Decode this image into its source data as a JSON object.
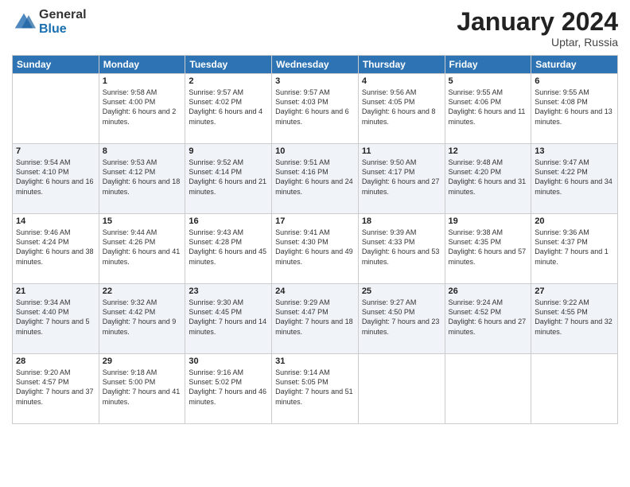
{
  "header": {
    "logo_general": "General",
    "logo_blue": "Blue",
    "month_year": "January 2024",
    "location": "Uptar, Russia"
  },
  "days_of_week": [
    "Sunday",
    "Monday",
    "Tuesday",
    "Wednesday",
    "Thursday",
    "Friday",
    "Saturday"
  ],
  "weeks": [
    [
      {
        "day": "",
        "info": ""
      },
      {
        "day": "1",
        "info": "Sunrise: 9:58 AM\nSunset: 4:00 PM\nDaylight: 6 hours\nand 2 minutes."
      },
      {
        "day": "2",
        "info": "Sunrise: 9:57 AM\nSunset: 4:02 PM\nDaylight: 6 hours\nand 4 minutes."
      },
      {
        "day": "3",
        "info": "Sunrise: 9:57 AM\nSunset: 4:03 PM\nDaylight: 6 hours\nand 6 minutes."
      },
      {
        "day": "4",
        "info": "Sunrise: 9:56 AM\nSunset: 4:05 PM\nDaylight: 6 hours\nand 8 minutes."
      },
      {
        "day": "5",
        "info": "Sunrise: 9:55 AM\nSunset: 4:06 PM\nDaylight: 6 hours\nand 11 minutes."
      },
      {
        "day": "6",
        "info": "Sunrise: 9:55 AM\nSunset: 4:08 PM\nDaylight: 6 hours\nand 13 minutes."
      }
    ],
    [
      {
        "day": "7",
        "info": "Sunrise: 9:54 AM\nSunset: 4:10 PM\nDaylight: 6 hours\nand 16 minutes."
      },
      {
        "day": "8",
        "info": "Sunrise: 9:53 AM\nSunset: 4:12 PM\nDaylight: 6 hours\nand 18 minutes."
      },
      {
        "day": "9",
        "info": "Sunrise: 9:52 AM\nSunset: 4:14 PM\nDaylight: 6 hours\nand 21 minutes."
      },
      {
        "day": "10",
        "info": "Sunrise: 9:51 AM\nSunset: 4:16 PM\nDaylight: 6 hours\nand 24 minutes."
      },
      {
        "day": "11",
        "info": "Sunrise: 9:50 AM\nSunset: 4:17 PM\nDaylight: 6 hours\nand 27 minutes."
      },
      {
        "day": "12",
        "info": "Sunrise: 9:48 AM\nSunset: 4:20 PM\nDaylight: 6 hours\nand 31 minutes."
      },
      {
        "day": "13",
        "info": "Sunrise: 9:47 AM\nSunset: 4:22 PM\nDaylight: 6 hours\nand 34 minutes."
      }
    ],
    [
      {
        "day": "14",
        "info": "Sunrise: 9:46 AM\nSunset: 4:24 PM\nDaylight: 6 hours\nand 38 minutes."
      },
      {
        "day": "15",
        "info": "Sunrise: 9:44 AM\nSunset: 4:26 PM\nDaylight: 6 hours\nand 41 minutes."
      },
      {
        "day": "16",
        "info": "Sunrise: 9:43 AM\nSunset: 4:28 PM\nDaylight: 6 hours\nand 45 minutes."
      },
      {
        "day": "17",
        "info": "Sunrise: 9:41 AM\nSunset: 4:30 PM\nDaylight: 6 hours\nand 49 minutes."
      },
      {
        "day": "18",
        "info": "Sunrise: 9:39 AM\nSunset: 4:33 PM\nDaylight: 6 hours\nand 53 minutes."
      },
      {
        "day": "19",
        "info": "Sunrise: 9:38 AM\nSunset: 4:35 PM\nDaylight: 6 hours\nand 57 minutes."
      },
      {
        "day": "20",
        "info": "Sunrise: 9:36 AM\nSunset: 4:37 PM\nDaylight: 7 hours\nand 1 minute."
      }
    ],
    [
      {
        "day": "21",
        "info": "Sunrise: 9:34 AM\nSunset: 4:40 PM\nDaylight: 7 hours\nand 5 minutes."
      },
      {
        "day": "22",
        "info": "Sunrise: 9:32 AM\nSunset: 4:42 PM\nDaylight: 7 hours\nand 9 minutes."
      },
      {
        "day": "23",
        "info": "Sunrise: 9:30 AM\nSunset: 4:45 PM\nDaylight: 7 hours\nand 14 minutes."
      },
      {
        "day": "24",
        "info": "Sunrise: 9:29 AM\nSunset: 4:47 PM\nDaylight: 7 hours\nand 18 minutes."
      },
      {
        "day": "25",
        "info": "Sunrise: 9:27 AM\nSunset: 4:50 PM\nDaylight: 7 hours\nand 23 minutes."
      },
      {
        "day": "26",
        "info": "Sunrise: 9:24 AM\nSunset: 4:52 PM\nDaylight: 6 hours\nand 27 minutes."
      },
      {
        "day": "27",
        "info": "Sunrise: 9:22 AM\nSunset: 4:55 PM\nDaylight: 7 hours\nand 32 minutes."
      }
    ],
    [
      {
        "day": "28",
        "info": "Sunrise: 9:20 AM\nSunset: 4:57 PM\nDaylight: 7 hours\nand 37 minutes."
      },
      {
        "day": "29",
        "info": "Sunrise: 9:18 AM\nSunset: 5:00 PM\nDaylight: 7 hours\nand 41 minutes."
      },
      {
        "day": "30",
        "info": "Sunrise: 9:16 AM\nSunset: 5:02 PM\nDaylight: 7 hours\nand 46 minutes."
      },
      {
        "day": "31",
        "info": "Sunrise: 9:14 AM\nSunset: 5:05 PM\nDaylight: 7 hours\nand 51 minutes."
      },
      {
        "day": "",
        "info": ""
      },
      {
        "day": "",
        "info": ""
      },
      {
        "day": "",
        "info": ""
      }
    ]
  ]
}
